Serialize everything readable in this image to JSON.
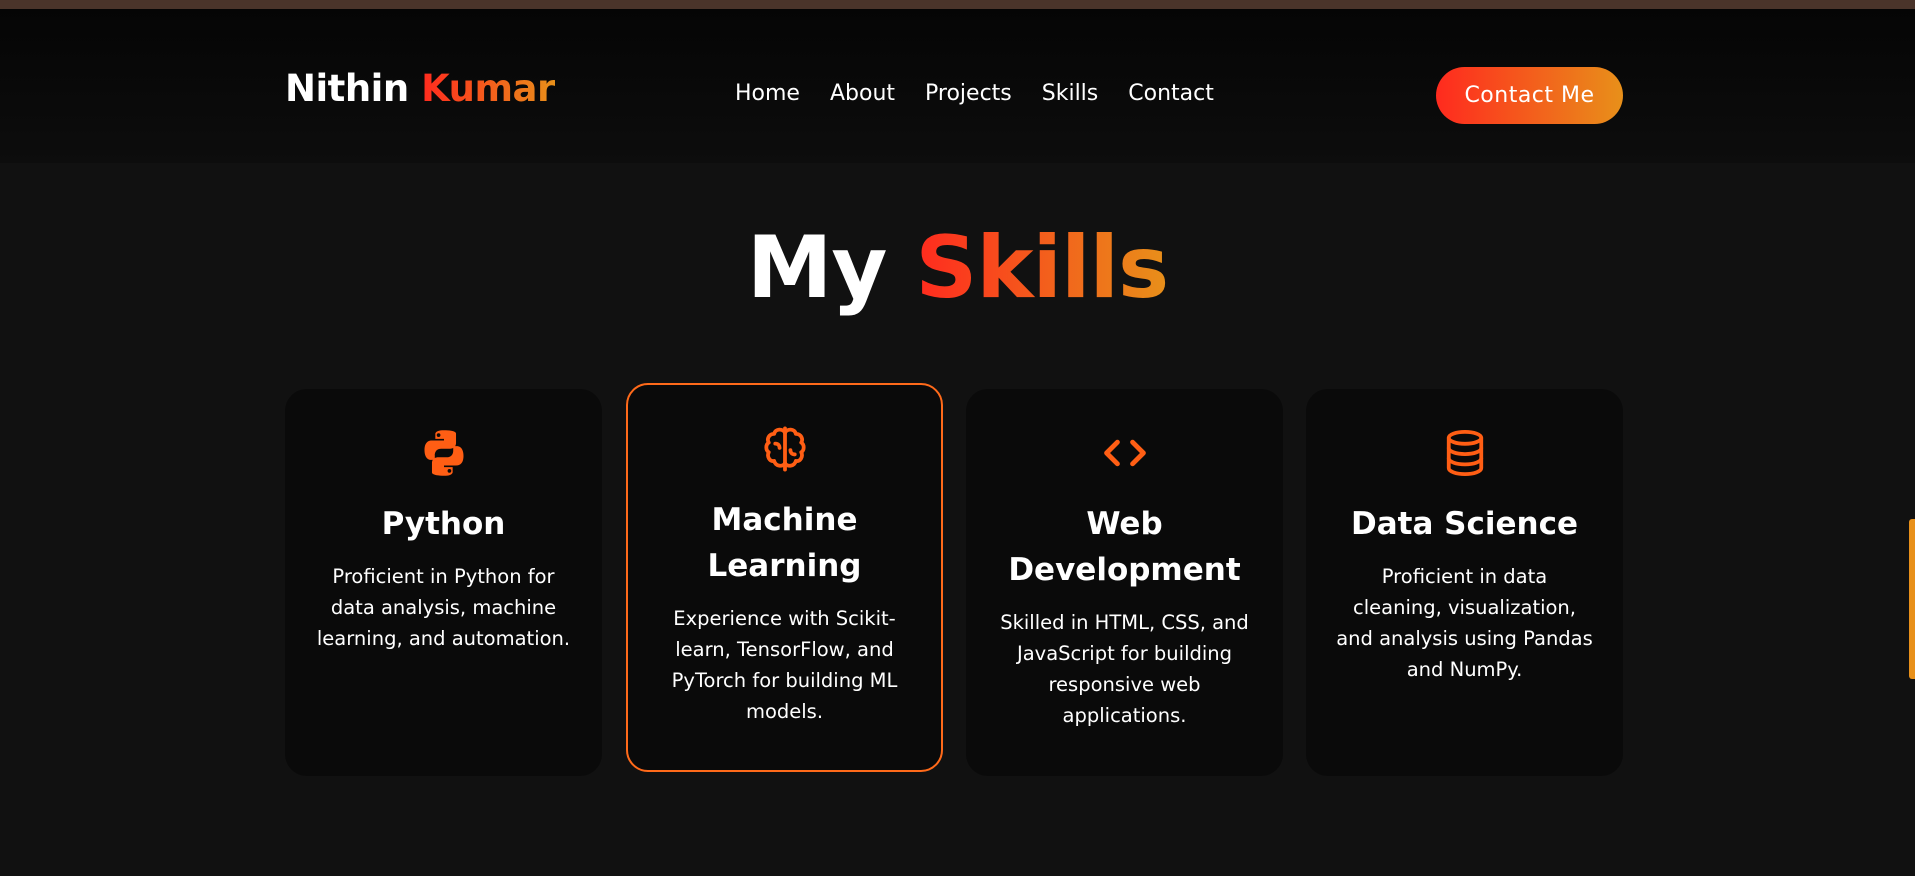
{
  "brand": {
    "first": "Nithin",
    "last": "Kumar"
  },
  "nav": {
    "links": [
      "Home",
      "About",
      "Projects",
      "Skills",
      "Contact"
    ],
    "cta_label": "Contact Me"
  },
  "section": {
    "heading_plain": "My",
    "heading_accent": "Skills"
  },
  "skills": [
    {
      "icon": "python-icon",
      "title": "Python",
      "description": "Proficient in Python for data analysis, machine learning, and automation."
    },
    {
      "icon": "brain-icon",
      "title": "Machine Learning",
      "description": "Experience with Scikit-learn, TensorFlow, and PyTorch for building ML models."
    },
    {
      "icon": "code-icon",
      "title": "Web Development",
      "description": "Skilled in HTML, CSS, and JavaScript for building responsive web applications."
    },
    {
      "icon": "database-icon",
      "title": "Data Science",
      "description": "Proficient in data cleaning, visualization, and analysis using Pandas and NumPy."
    }
  ],
  "colors": {
    "accent_start": "#ff2a1e",
    "accent_end": "#e8901a",
    "icon": "#ff5e14",
    "background": "#111111",
    "card": "#0a0a0a"
  }
}
